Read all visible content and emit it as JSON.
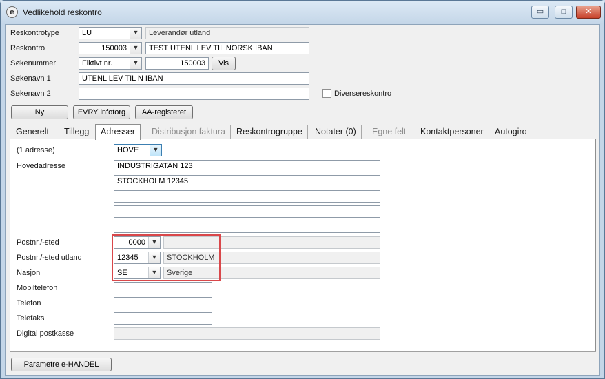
{
  "window": {
    "title": "Vedlikehold reskontro",
    "app_icon_glyph": "e",
    "controls": {
      "minimize": "▭",
      "maximize": "□",
      "close": "✕"
    }
  },
  "header": {
    "reskontrotype": {
      "label": "Reskontrotype",
      "value": "LU",
      "description": "Leverandør utland"
    },
    "reskontro": {
      "label": "Reskontro",
      "value": "150003",
      "description": "TEST UTENL LEV TIL NORSK IBAN"
    },
    "sokenummer": {
      "label": "Søkenummer",
      "type_value": "Fiktivt nr.",
      "value": "150003",
      "show_button": "Vis"
    },
    "sokenavn1": {
      "label": "Søkenavn 1",
      "value": "UTENL LEV TIL N IBAN"
    },
    "sokenavn2": {
      "label": "Søkenavn 2",
      "value": ""
    },
    "diverse": {
      "label": "Diversereskontro",
      "checked": false
    }
  },
  "action_buttons": {
    "ny": "Ny",
    "evry": "EVRY infotorg",
    "aa": "AA-registeret"
  },
  "tabs": [
    {
      "label": "Generelt",
      "state": "normal"
    },
    {
      "label": "Tillegg",
      "state": "normal"
    },
    {
      "label": "Adresser",
      "state": "active"
    },
    {
      "label": "Distribusjon faktura",
      "state": "disabled"
    },
    {
      "label": "Reskontrogruppe",
      "state": "normal"
    },
    {
      "label": "Notater (0)",
      "state": "normal"
    },
    {
      "label": "Egne felt",
      "state": "disabled"
    },
    {
      "label": "Kontaktpersoner",
      "state": "normal"
    },
    {
      "label": "Autogiro",
      "state": "normal"
    }
  ],
  "address": {
    "count_label": "(1 adresse)",
    "type_value": "HOVE",
    "main_label": "Hovedadresse",
    "lines": [
      "INDUSTRIGATAN 123",
      "STOCKHOLM 12345",
      "",
      "",
      ""
    ],
    "postnr": {
      "label": "Postnr./-sted",
      "value": "0000",
      "place": ""
    },
    "postnr_utland": {
      "label": "Postnr./-sted utland",
      "value": "12345",
      "place": "STOCKHOLM"
    },
    "nasjon": {
      "label": "Nasjon",
      "value": "SE",
      "name": "Sverige"
    },
    "mobil": {
      "label": "Mobiltelefon",
      "value": ""
    },
    "telefon": {
      "label": "Telefon",
      "value": ""
    },
    "telefaks": {
      "label": "Telefaks",
      "value": ""
    },
    "digital": {
      "label": "Digital postkasse",
      "value": ""
    }
  },
  "footer": {
    "parametre_button": "Parametre e-HANDEL"
  },
  "colors": {
    "highlight": "#d9474a",
    "window_frame": "#c4d6e8",
    "client_bg": "#f0f0f0"
  }
}
